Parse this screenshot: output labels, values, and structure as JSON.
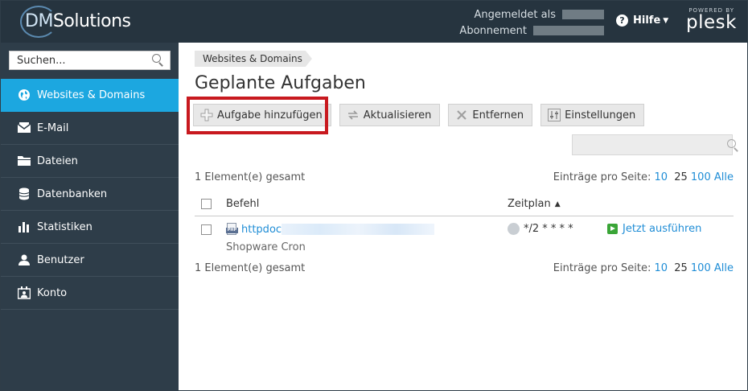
{
  "header": {
    "brand_prefix": "DM",
    "brand_suffix": "Solutions",
    "logged_in_label": "Angemeldet als",
    "subscription_label": "Abonnement",
    "help_label": "Hilfe",
    "powered_by": "POWERED BY",
    "plesk": "plesk"
  },
  "sidebar": {
    "search_placeholder": "Suchen...",
    "items": [
      {
        "label": "Websites & Domains",
        "icon": "globe-icon",
        "active": true
      },
      {
        "label": "E-Mail",
        "icon": "mail-icon"
      },
      {
        "label": "Dateien",
        "icon": "folder-icon"
      },
      {
        "label": "Datenbanken",
        "icon": "database-icon"
      },
      {
        "label": "Statistiken",
        "icon": "bar-chart-icon"
      },
      {
        "label": "Benutzer",
        "icon": "user-icon"
      },
      {
        "label": "Konto",
        "icon": "account-icon"
      }
    ]
  },
  "main": {
    "breadcrumb": "Websites & Domains",
    "title": "Geplante Aufgaben",
    "toolbar": {
      "add": "Aufgabe hinzufügen",
      "refresh": "Aktualisieren",
      "remove": "Entfernen",
      "settings": "Einstellungen"
    },
    "total_label": "1 Element(e) gesamt",
    "per_page_label": "Einträge pro Seite:",
    "per_page_options": [
      "10",
      "25",
      "100",
      "Alle"
    ],
    "columns": {
      "command": "Befehl",
      "schedule": "Zeitplan"
    },
    "rows": [
      {
        "command": "httpdoc",
        "subtitle": "Shopware Cron",
        "schedule": "*/2 * * * *",
        "action": "Jetzt ausführen"
      }
    ]
  },
  "colors": {
    "accent": "#1ca7e0",
    "header": "#26343f",
    "sidebar": "#2e3d49",
    "highlight": "#c8191f",
    "link": "#1f8dd6"
  }
}
